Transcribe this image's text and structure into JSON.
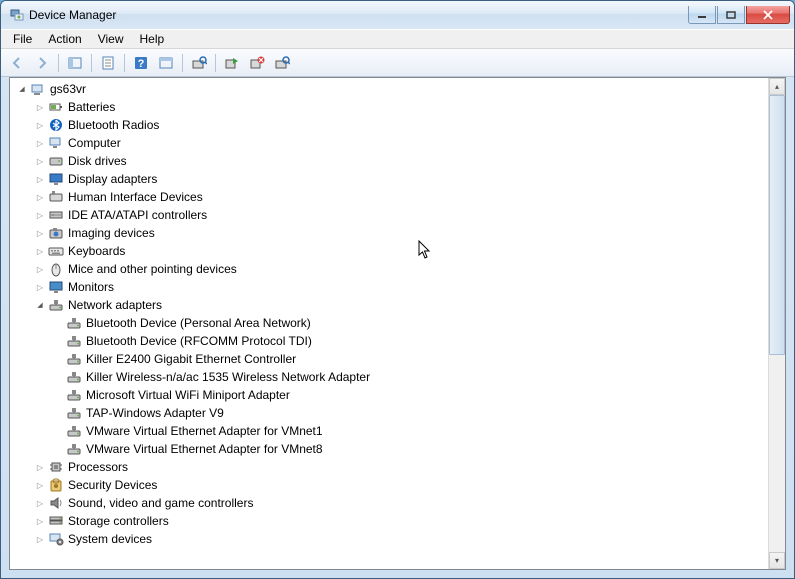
{
  "window": {
    "title": "Device Manager"
  },
  "menu": {
    "file": "File",
    "action": "Action",
    "view": "View",
    "help": "Help"
  },
  "tree": {
    "root": "gs63vr",
    "categories": [
      {
        "label": "Batteries",
        "icon": "battery",
        "expanded": false
      },
      {
        "label": "Bluetooth Radios",
        "icon": "bluetooth",
        "expanded": false
      },
      {
        "label": "Computer",
        "icon": "computer",
        "expanded": false
      },
      {
        "label": "Disk drives",
        "icon": "disk",
        "expanded": false
      },
      {
        "label": "Display adapters",
        "icon": "display",
        "expanded": false
      },
      {
        "label": "Human Interface Devices",
        "icon": "hid",
        "expanded": false
      },
      {
        "label": "IDE ATA/ATAPI controllers",
        "icon": "ide",
        "expanded": false
      },
      {
        "label": "Imaging devices",
        "icon": "imaging",
        "expanded": false
      },
      {
        "label": "Keyboards",
        "icon": "keyboard",
        "expanded": false
      },
      {
        "label": "Mice and other pointing devices",
        "icon": "mouse",
        "expanded": false
      },
      {
        "label": "Monitors",
        "icon": "monitor",
        "expanded": false
      },
      {
        "label": "Network adapters",
        "icon": "network",
        "expanded": true,
        "children": [
          "Bluetooth Device (Personal Area Network)",
          "Bluetooth Device (RFCOMM Protocol TDI)",
          "Killer E2400 Gigabit Ethernet Controller",
          "Killer Wireless-n/a/ac 1535 Wireless Network Adapter",
          "Microsoft Virtual WiFi Miniport Adapter",
          "TAP-Windows Adapter V9",
          "VMware Virtual Ethernet Adapter for VMnet1",
          "VMware Virtual Ethernet Adapter for VMnet8"
        ]
      },
      {
        "label": "Processors",
        "icon": "cpu",
        "expanded": false
      },
      {
        "label": "Security Devices",
        "icon": "security",
        "expanded": false
      },
      {
        "label": "Sound, video and game controllers",
        "icon": "sound",
        "expanded": false
      },
      {
        "label": "Storage controllers",
        "icon": "storage",
        "expanded": false
      },
      {
        "label": "System devices",
        "icon": "system",
        "expanded": false
      }
    ]
  }
}
